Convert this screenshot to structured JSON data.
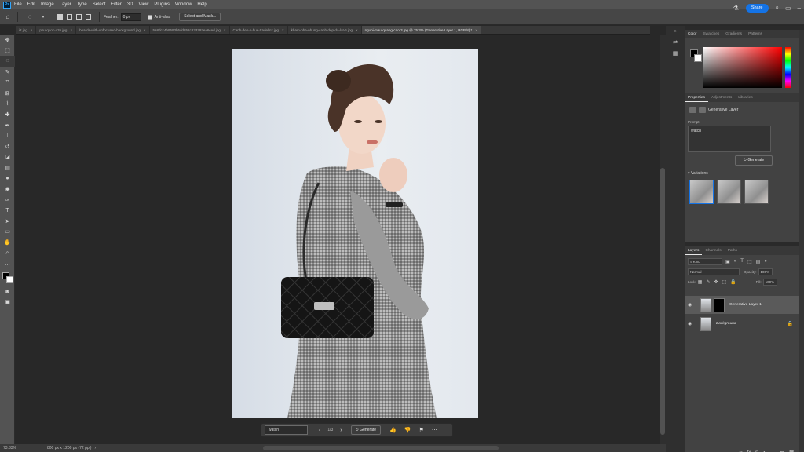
{
  "menubar": {
    "logo": "Ps",
    "items": [
      "File",
      "Edit",
      "Image",
      "Layer",
      "Type",
      "Select",
      "Filter",
      "3D",
      "View",
      "Plugins",
      "Window",
      "Help"
    ]
  },
  "options": {
    "feather_label": "Feather:",
    "feather_value": "0 px",
    "antialias_label": "Anti-alias",
    "select_mask_label": "Select and Mask..."
  },
  "topright": {
    "share_label": "Share"
  },
  "tabs": [
    {
      "label": "i2.jpg"
    },
    {
      "label": "phu-quoc-435.jpg"
    },
    {
      "label": "boards-with-unfocused-background.jpg"
    },
    {
      "label": "5a8dcc4b9593b5dd852c823793ea6ced.jpg"
    },
    {
      "label": "Canh-dep-o-hue-tradelinx.jpg"
    },
    {
      "label": "kham-pha-nhung-canh-dep-da-lat-6.jpg"
    },
    {
      "label": "nguoi-mau-quang-cao-3.jpg @ 75.3% (Generative Layer 1, RGB/8) *",
      "active": true
    }
  ],
  "context_bar": {
    "prompt": "watch",
    "page": "1/3",
    "generate_label": "Generate"
  },
  "status": {
    "zoom": "73.33%",
    "doc": "800 px x 1200 px (72 ppi)"
  },
  "color_panel": {
    "tabs": [
      "Color",
      "Swatches",
      "Gradients",
      "Patterns"
    ]
  },
  "properties_panel": {
    "tabs": [
      "Properties",
      "Adjustments",
      "Libraries"
    ],
    "layer_type": "Generative Layer",
    "prompt_label": "Prompt",
    "prompt_value": "watch",
    "generate_label": "Generate",
    "variations_label": "Variations"
  },
  "layers_panel": {
    "tabs": [
      "Layers",
      "Channels",
      "Paths"
    ],
    "kind": "Kind",
    "blend_mode": "Normal",
    "opacity_label": "Opacity:",
    "opacity_value": "100%",
    "lock_label": "Lock:",
    "fill_label": "Fill:",
    "fill_value": "100%",
    "layers": [
      {
        "name": "Generative Layer 1"
      },
      {
        "name": "Background"
      }
    ]
  },
  "icons": {
    "tools": [
      "move",
      "artboard",
      "lasso",
      "object-select",
      "crop",
      "frame",
      "eyedropper",
      "healing",
      "brush",
      "stamp",
      "history-brush",
      "eraser",
      "gradient",
      "blur",
      "dodge",
      "pen",
      "type",
      "path-select",
      "rectangle",
      "hand",
      "zoom",
      "more"
    ]
  }
}
